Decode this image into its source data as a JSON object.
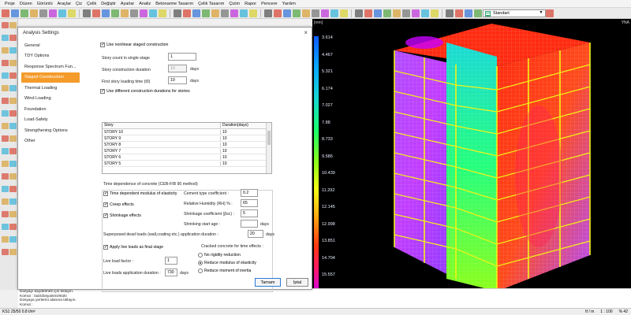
{
  "menu": [
    "Proje",
    "Düzen",
    "Görüntü",
    "Araçlar",
    "Çiz",
    "Çelik",
    "Değiştir",
    "Ayarlar",
    "Analiz",
    "Betonarme Tasarım",
    "Çelik Tasarım",
    "Çizim",
    "Rapor",
    "Pencere",
    "Yardım"
  ],
  "style_combo": "Standart",
  "viewport": {
    "unit": "[mm]",
    "corner": "YNA",
    "legend": [
      "3.614",
      "4.467",
      "5.321",
      "6.174",
      "7.027",
      "7.88",
      "8.733",
      "9.586",
      "10.439",
      "11.292",
      "12.145",
      "12.998",
      "13.851",
      "14.704",
      "15.557",
      "16.41"
    ],
    "colors": {
      "magenta": "#b14dff",
      "red": "#ff2b10",
      "yellow": "#f3f218",
      "green": "#23ff7a",
      "cyan": "#19d9d6"
    }
  },
  "dialog": {
    "title": "Analysis Settings",
    "close": "×",
    "nav": [
      "General",
      "TDY Options",
      "Response Spectrum Fun...",
      "Staged Construction",
      "Thermal Loading",
      "Wind Loading",
      "Foundation",
      "Load-Safety",
      "Strengthening Options",
      "Other"
    ],
    "active_nav": 3,
    "use_nonlinear": "Use nonlinear staged construction",
    "story_count_label": "Story count in single stage",
    "story_count": "1",
    "construction_duration_label": "Story construction duration",
    "construction_duration": "10",
    "first_loading_label": "First story loading time (t0)",
    "first_loading": "10",
    "days": "days",
    "use_different": "Use different construction durations for stories",
    "stories_header": {
      "story": "Story",
      "duration": "Duration(days)"
    },
    "stories": [
      {
        "name": "STORY 10",
        "duration": "10"
      },
      {
        "name": "STORY 9",
        "duration": "10"
      },
      {
        "name": "STORY 8",
        "duration": "10"
      },
      {
        "name": "STORY 7",
        "duration": "10"
      },
      {
        "name": "STORY 6",
        "duration": "10"
      },
      {
        "name": "STORY 5",
        "duration": "10"
      }
    ],
    "time_dep_title": "Time dependence of concrete (CEB-FIB 90 method)",
    "time_dep_modulus": "Time dependent modulus of elasticity",
    "creep": "Creep effects",
    "shrinkage": "Shrinkage effects",
    "cement_label": "Cement type coefficient :",
    "cement": "0.2",
    "humidity_label": "Relative Humidity (RH) % :",
    "humidity": "65",
    "shrink_coef_label": "Shrinkage coefficient (βsc) :",
    "shrink_coef": "5",
    "shrink_start_label": "Shrinking start age :",
    "shrink_start": "",
    "superimposed_label": "Superposed dead loads (wall,coating etc.) application duration :",
    "superimposed": "20",
    "apply_live": "Apply live loads as final stage",
    "cracked_title": "Cracked concrete for time effects :",
    "no_rigidity": "No rigidity reduction",
    "reduce_modulus": "Reduce modulus of elasticity",
    "reduce_inertia": "Reduce moment of inertia",
    "live_factor_label": "Live load factor :",
    "live_factor": "1",
    "live_duration_label": "Live loads application duration :",
    "live_duration": "730",
    "ok": "Tamam",
    "cancel": "İptal"
  },
  "command": [
    "Dosyayı kaydetmek için tıklayın.",
    "Komut : /adı/dosyaismi/stoki",
    "Dosyaya yerlerini alanına tıklayın.",
    "Komut :"
  ],
  "status": {
    "left": "KS1 25/50 0.8 t/m²",
    "unit": "tf / m",
    "scale": "1 : 100",
    "zoom": "% 42"
  }
}
